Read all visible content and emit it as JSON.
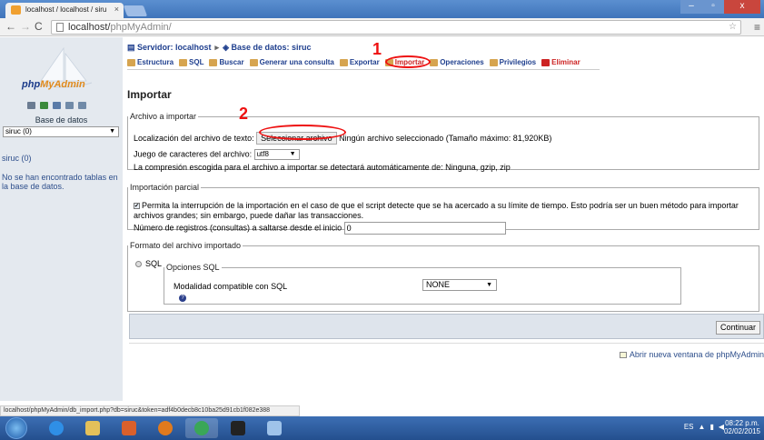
{
  "browser": {
    "tab_title": "localhost / localhost / siru",
    "tab_close": "×",
    "url_host": "localhost/",
    "url_path": "phpMyAdmin/",
    "window_min": "–",
    "window_max": "▫",
    "window_close": "x"
  },
  "sidebar": {
    "logo": {
      "php": "php",
      "myadmin": "MyAdmin"
    },
    "db_label": "Base de datos",
    "db_select_value": "siruc (0)",
    "db_link": "siruc (0)",
    "no_tables": "No se han encontrado tablas en la base de datos."
  },
  "main": {
    "breadcrumb": {
      "server": "Servidor: localhost",
      "database": "Base de datos: siruc"
    },
    "tabs": [
      {
        "label": "Estructura",
        "icon": "structure-icon"
      },
      {
        "label": "SQL",
        "icon": "sql-icon"
      },
      {
        "label": "Buscar",
        "icon": "search-icon"
      },
      {
        "label": "Generar una consulta",
        "icon": "query-icon"
      },
      {
        "label": "Exportar",
        "icon": "export-icon"
      },
      {
        "label": "Importar",
        "icon": "import-icon"
      },
      {
        "label": "Operaciones",
        "icon": "operations-icon"
      },
      {
        "label": "Privilegios",
        "icon": "privileges-icon"
      },
      {
        "label": "Eliminar",
        "icon": "delete-icon"
      }
    ],
    "annotation_1": "1",
    "annotation_2": "2",
    "heading": "Importar",
    "file_section": {
      "legend": "Archivo a importar",
      "location_label": "Localización del archivo de texto:",
      "choose_button": "Seleccionar archivo",
      "no_file": "Ningún archivo seleccionado",
      "max_size": "(Tamaño máximo: 81,920KB)",
      "charset_label": "Juego de caracteres del archivo:",
      "charset_value": "utf8",
      "compression_note": "La compresión escogida para el archivo a importar se detectará automáticamente de: Ninguna, gzip, zip"
    },
    "partial_section": {
      "legend": "Importación parcial",
      "allow_interrupt": "Permita la interrupción de la importación en el caso de que el script detecte que se ha acercado a su límite de tiempo. Esto podría ser un buen método para importar",
      "allow_interrupt_2": "archivos grandes; sin embargo, puede dañar las transacciones.",
      "skip_label": "Número de registros (consultas) a saltarse desde el inicio",
      "skip_value": "0"
    },
    "format_section": {
      "legend": "Formato del archivo importado",
      "format_value": "SQL",
      "sql_options_legend": "Opciones SQL",
      "compat_label": "Modalidad compatible con SQL",
      "compat_value": "NONE"
    },
    "continue_button": "Continuar",
    "new_window_link": "Abrir nueva ventana de phpMyAdmin"
  },
  "status_url": "localhost/phpMyAdmin/db_import.php?db=siruc&token=adf4b0decb8c10ba25d91cb1f082e388",
  "taskbar": {
    "lang": "ES",
    "time": "08:22 p.m.",
    "date": "02/02/2015"
  },
  "colors": {
    "accent": "#1f3f8e",
    "annotation": "#ee1111",
    "sidebar_bg": "#e4e9ef"
  }
}
